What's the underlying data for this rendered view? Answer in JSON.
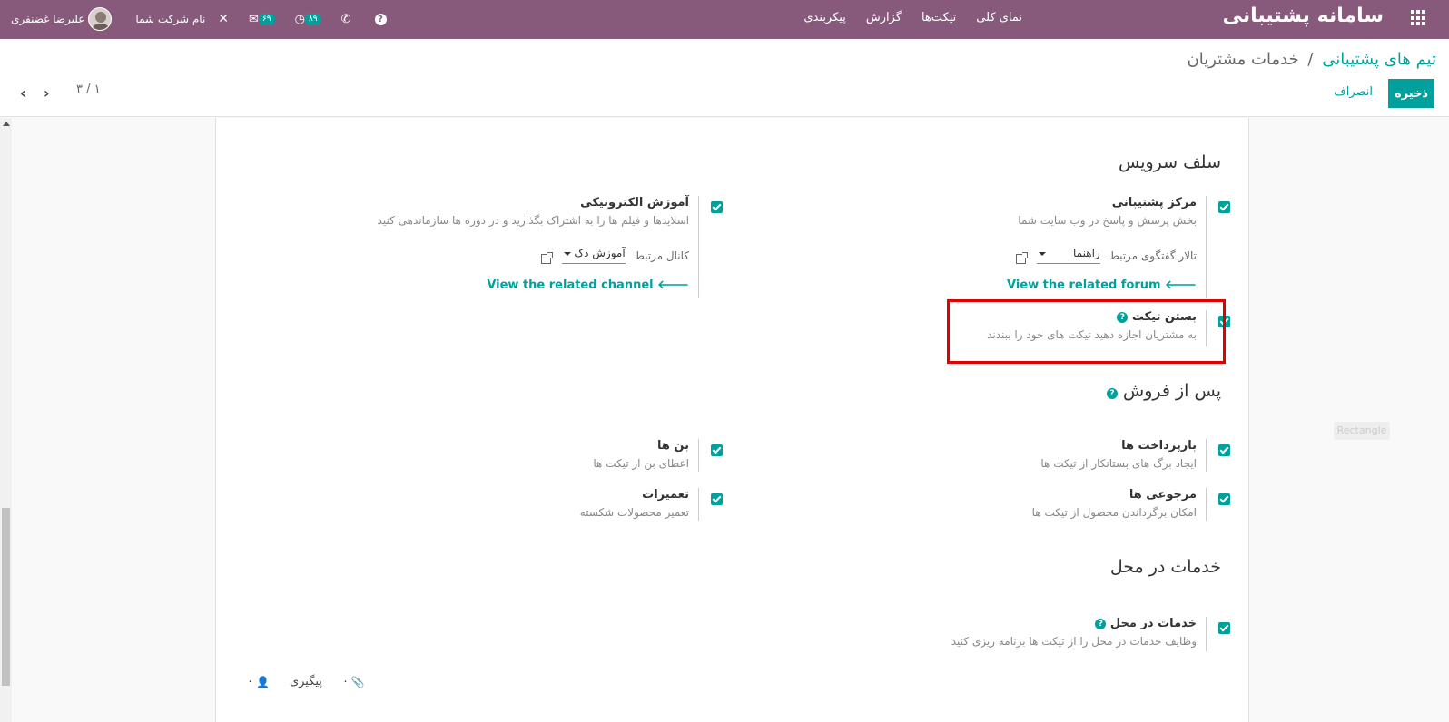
{
  "navbar": {
    "brand": "سامانه پشتیبانی",
    "menu": [
      "نمای کلی",
      "تیکت‌ها",
      "گزارش",
      "پیکربندی"
    ],
    "user_name": "علیرضا غضنفری",
    "company": "نام شرکت شما",
    "chat_count": "۶۹",
    "activity_count": "۸۹",
    "icons": [
      "apps-grid-icon",
      "tools-icon",
      "chat-icon",
      "clock-icon",
      "phone-icon",
      "help-icon"
    ]
  },
  "breadcrumb": {
    "parent": "تیم های پشتیبانی",
    "separator": "/",
    "current": "خدمات مشتریان"
  },
  "actions": {
    "save": "ذخیره",
    "discard": "انصراف"
  },
  "pager": {
    "value": "۳ / ۱"
  },
  "sections": {
    "self_service": "سلف سرویس",
    "after_sales": "پس از فروش",
    "field_service": "خدمات در محل"
  },
  "settings": {
    "help_center": {
      "label": "مرکز پشتیبانی",
      "desc": "بخش پرسش و پاسخ در وب سایت شما",
      "related_label": "تالار گفتگوی مرتبط",
      "related_value": "راهنما",
      "link": "View the related forum"
    },
    "elearning": {
      "label": "آموزش الکترونیکی",
      "desc": "اسلایدها و فیلم ها را به اشتراک بگذارید و در دوره ها سازماندهی کنید",
      "related_label": "کانال مرتبط",
      "related_value": "آموزش دک",
      "link": "View the related channel"
    },
    "close_ticket": {
      "label": "بستن تیکت",
      "desc": "به مشتریان اجازه دهید تیکت های خود را ببندند"
    },
    "refunds": {
      "label": "بازپرداخت ها",
      "desc": "ایجاد برگ های بستانکار از تیکت ها"
    },
    "coupons": {
      "label": "بن ها",
      "desc": "اعطای بن از تیکت ها"
    },
    "returns": {
      "label": "مرجوعی ها",
      "desc": "امکان برگرداندن محصول از تیکت ها"
    },
    "repairs": {
      "label": "تعمیرات",
      "desc": "تعمیر محصولات شکسته"
    },
    "field_service": {
      "label": "خدمات در محل",
      "desc": "وظایف خدمات در محل را از تیکت ها برنامه ریزی کنید"
    }
  },
  "chatter": {
    "attachments": "۰",
    "follow": "پیگیری",
    "followers": "۰"
  },
  "overlay_tag": "Rectangle",
  "colors": {
    "navbar": "#875a7b",
    "accent": "#00a09d",
    "highlight": "#e00000"
  }
}
